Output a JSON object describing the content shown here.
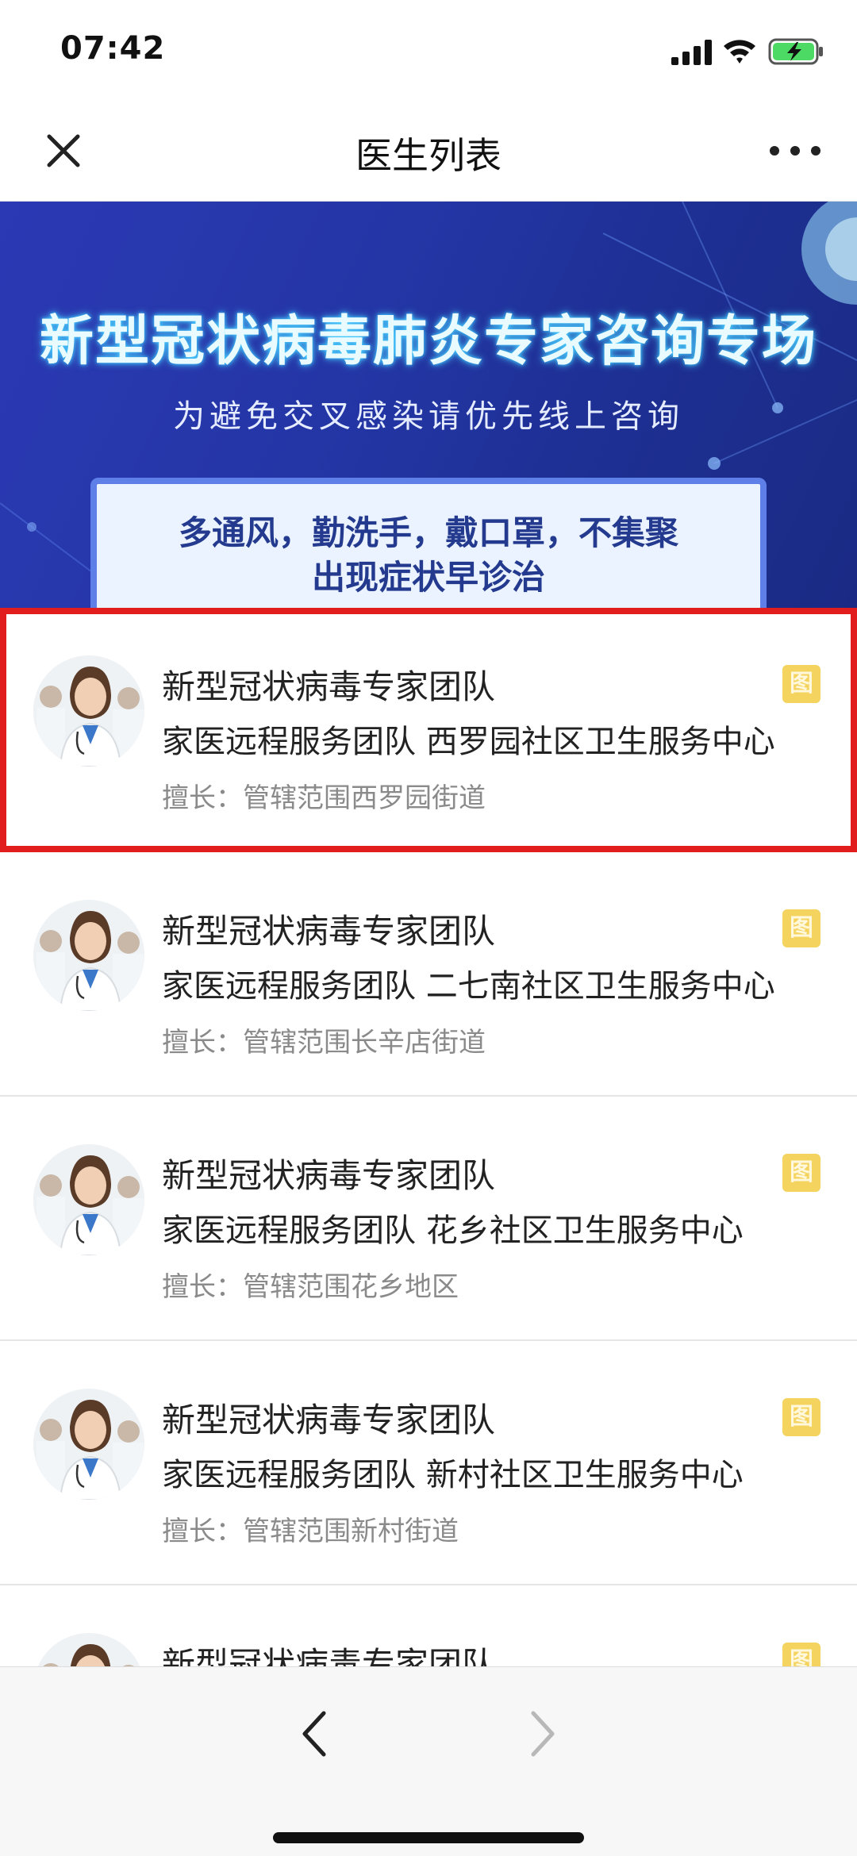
{
  "status_bar": {
    "time": "07:42",
    "signal_icon": "cellular-signal-icon",
    "wifi_icon": "wifi-icon",
    "battery_icon": "battery-charging-icon"
  },
  "nav": {
    "title": "医生列表",
    "close_icon": "close-icon",
    "more_icon": "more-dots-icon"
  },
  "banner": {
    "title": "新型冠状病毒肺炎专家咨询专场",
    "subtitle": "为避免交叉感染请优先线上咨询",
    "box_line1": "多通风，勤洗手，戴口罩，不集聚",
    "box_line2": "出现症状早诊治"
  },
  "doctors": [
    {
      "title": "新型冠状病毒专家团队",
      "subtitle": "家医远程服务团队 西罗园社区卫生服务中心",
      "specialty": "擅长：管辖范围西罗园街道",
      "badge": "图",
      "highlighted": true
    },
    {
      "title": "新型冠状病毒专家团队",
      "subtitle": "家医远程服务团队 二七南社区卫生服务中心",
      "specialty": "擅长：管辖范围长辛店街道",
      "badge": "图",
      "highlighted": false
    },
    {
      "title": "新型冠状病毒专家团队",
      "subtitle": "家医远程服务团队 花乡社区卫生服务中心",
      "specialty": "擅长：管辖范围花乡地区",
      "badge": "图",
      "highlighted": false
    },
    {
      "title": "新型冠状病毒专家团队",
      "subtitle": "家医远程服务团队 新村社区卫生服务中心",
      "specialty": "擅长：管辖范围新村街道",
      "badge": "图",
      "highlighted": false
    },
    {
      "title": "新型冠状病毒专家团队",
      "subtitle": "",
      "specialty": "",
      "badge": "图",
      "highlighted": false
    }
  ],
  "toolbar": {
    "back_icon": "chevron-left-icon",
    "forward_icon": "chevron-right-icon"
  },
  "colors": {
    "banner": "#2436a6",
    "highlight": "#e21d1d",
    "badge": "#f4d35e"
  }
}
